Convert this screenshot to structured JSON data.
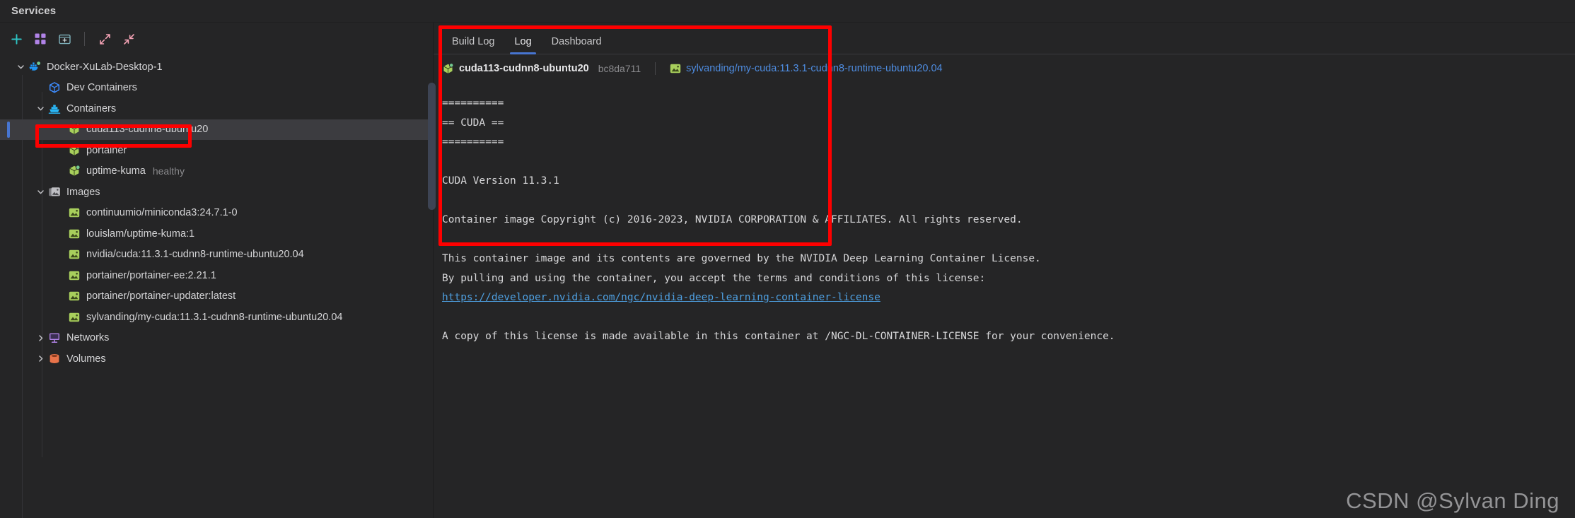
{
  "view": {
    "title": "Services"
  },
  "toolbar": {
    "buttons": [
      {
        "name": "add-icon",
        "title": "Add"
      },
      {
        "name": "grid-view-icon",
        "title": "Group by"
      },
      {
        "name": "new-window-icon",
        "title": "Create"
      },
      {
        "name": "expand-all-icon",
        "title": "Expand All"
      },
      {
        "name": "collapse-all-icon",
        "title": "Collapse All"
      }
    ]
  },
  "sidebar": {
    "tree": [
      {
        "label": "Docker-XuLab-Desktop-1",
        "icon": "docker-whale-icon",
        "depth": 0,
        "twisty": "down",
        "status": "running",
        "selected": false,
        "sub": ""
      },
      {
        "label": "Dev Containers",
        "icon": "cube-icon",
        "depth": 1,
        "twisty": "none",
        "status": "",
        "selected": false,
        "sub": ""
      },
      {
        "label": "Containers",
        "icon": "ship-icon",
        "depth": 1,
        "twisty": "down",
        "status": "",
        "selected": false,
        "sub": ""
      },
      {
        "label": "cuda113-cudnn8-ubuntu20",
        "icon": "container-icon",
        "depth": 2,
        "twisty": "none",
        "status": "running",
        "selected": true,
        "sub": ""
      },
      {
        "label": "portainer",
        "icon": "container-icon",
        "depth": 2,
        "twisty": "none",
        "status": "running",
        "selected": false,
        "sub": ""
      },
      {
        "label": "uptime-kuma",
        "icon": "container-icon",
        "depth": 2,
        "twisty": "none",
        "status": "running",
        "selected": false,
        "sub": "healthy"
      },
      {
        "label": "Images",
        "icon": "images-icon",
        "depth": 1,
        "twisty": "down",
        "status": "",
        "selected": false,
        "sub": ""
      },
      {
        "label": "continuumio/miniconda3:24.7.1-0",
        "icon": "image-icon",
        "depth": 2,
        "twisty": "none",
        "status": "",
        "selected": false,
        "sub": ""
      },
      {
        "label": "louislam/uptime-kuma:1",
        "icon": "image-icon",
        "depth": 2,
        "twisty": "none",
        "status": "",
        "selected": false,
        "sub": ""
      },
      {
        "label": "nvidia/cuda:11.3.1-cudnn8-runtime-ubuntu20.04",
        "icon": "image-icon",
        "depth": 2,
        "twisty": "none",
        "status": "",
        "selected": false,
        "sub": ""
      },
      {
        "label": "portainer/portainer-ee:2.21.1",
        "icon": "image-icon",
        "depth": 2,
        "twisty": "none",
        "status": "",
        "selected": false,
        "sub": ""
      },
      {
        "label": "portainer/portainer-updater:latest",
        "icon": "image-icon",
        "depth": 2,
        "twisty": "none",
        "status": "",
        "selected": false,
        "sub": ""
      },
      {
        "label": "sylvanding/my-cuda:11.3.1-cudnn8-runtime-ubuntu20.04",
        "icon": "image-icon",
        "depth": 2,
        "twisty": "none",
        "status": "",
        "selected": false,
        "sub": ""
      },
      {
        "label": "Networks",
        "icon": "network-icon",
        "depth": 1,
        "twisty": "right",
        "status": "",
        "selected": false,
        "sub": ""
      },
      {
        "label": "Volumes",
        "icon": "volume-icon",
        "depth": 1,
        "twisty": "right",
        "status": "",
        "selected": false,
        "sub": ""
      }
    ]
  },
  "main": {
    "tabs": [
      {
        "label": "Build Log",
        "active": false
      },
      {
        "label": "Log",
        "active": true
      },
      {
        "label": "Dashboard",
        "active": false
      }
    ],
    "breadcrumb": {
      "container_name": "cuda113-cudnn8-ubuntu20",
      "container_hash": "bc8da711",
      "image_link": "sylvanding/my-cuda:11.3.1-cudnn8-runtime-ubuntu20.04"
    },
    "log_lines": [
      {
        "text": "==========",
        "type": "text"
      },
      {
        "text": "== CUDA ==",
        "type": "text"
      },
      {
        "text": "==========",
        "type": "text"
      },
      {
        "text": "",
        "type": "text"
      },
      {
        "text": "CUDA Version 11.3.1",
        "type": "text"
      },
      {
        "text": "",
        "type": "text"
      },
      {
        "text": "Container image Copyright (c) 2016-2023, NVIDIA CORPORATION & AFFILIATES. All rights reserved.",
        "type": "text"
      },
      {
        "text": "",
        "type": "text"
      },
      {
        "text": "This container image and its contents are governed by the NVIDIA Deep Learning Container License.",
        "type": "text"
      },
      {
        "text": "By pulling and using the container, you accept the terms and conditions of this license:",
        "type": "text"
      },
      {
        "text": "https://developer.nvidia.com/ngc/nvidia-deep-learning-container-license",
        "type": "url"
      },
      {
        "text": "",
        "type": "text"
      },
      {
        "text": "A copy of this license is made available in this container at /NGC-DL-CONTAINER-LICENSE for your convenience.",
        "type": "text"
      }
    ]
  },
  "watermark": {
    "text": "CSDN @Sylvan Ding"
  },
  "colors": {
    "accent_blue": "#4775d1",
    "link_blue": "#4e8ce0",
    "annotation_red": "#fe0000",
    "running_green": "#73c991",
    "background": "#252526",
    "selected_row": "#3c3c40",
    "toolbar_teal": "#2ec4c4",
    "toolbar_purple": "#b183e8",
    "toolbar_pink": "#f3a2b4"
  }
}
